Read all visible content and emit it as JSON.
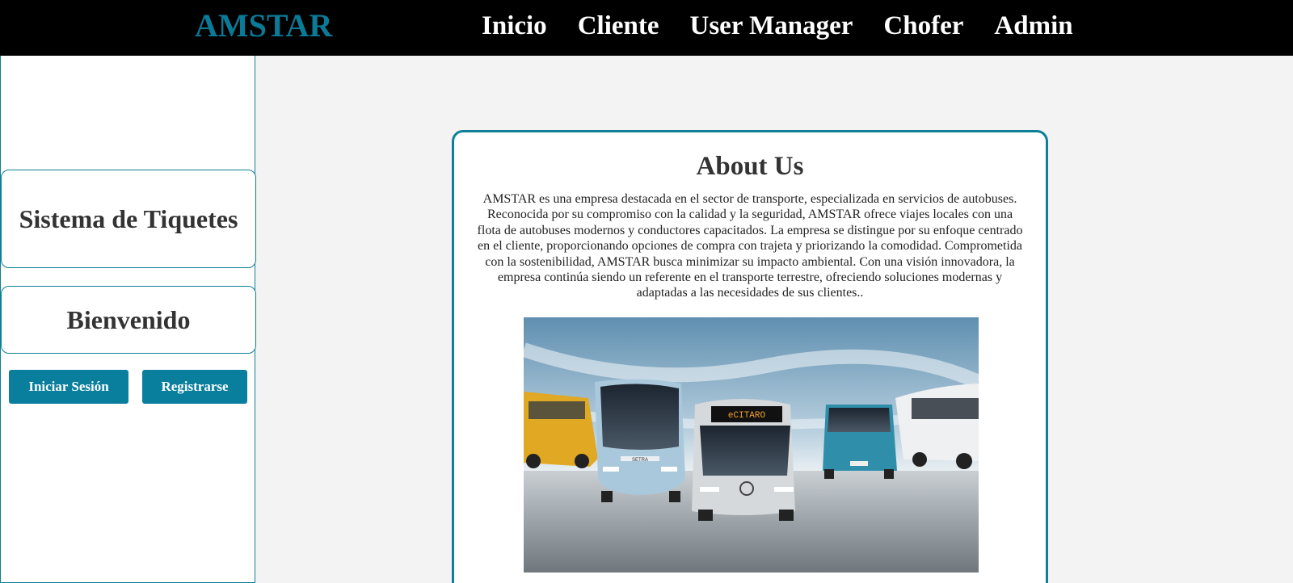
{
  "header": {
    "brand": "AMSTAR",
    "nav": [
      "Inicio",
      "Cliente",
      "User Manager",
      "Chofer",
      "Admin"
    ]
  },
  "sidebar": {
    "title": "Sistema de Tiquetes",
    "welcome": "Bienvenido",
    "login_label": "Iniciar Sesión",
    "register_label": "Registrarse"
  },
  "about": {
    "heading": "About Us",
    "body": "AMSTAR es una empresa destacada en el sector de transporte, especializada en servicios de autobuses. Reconocida por su compromiso con la calidad y la seguridad, AMSTAR ofrece viajes locales con una flota de autobuses modernos y conductores capacitados. La empresa se distingue por su enfoque centrado en el cliente, proporcionando opciones de compra con trajeta y priorizando la comodidad. Comprometida con la sostenibilidad, AMSTAR busca minimizar su impacto ambiental. Con una visión innovadora, la empresa continúa siendo un referente en el transporte terrestre, ofreciendo soluciones modernas y adaptadas a las necesidades de sus clientes..",
    "bus_sign": "eCITARO",
    "coach_badge": "SETRA"
  },
  "colors": {
    "accent": "#0a7f9d",
    "header_bg": "#000000",
    "page_bg": "#f3f3f3"
  }
}
